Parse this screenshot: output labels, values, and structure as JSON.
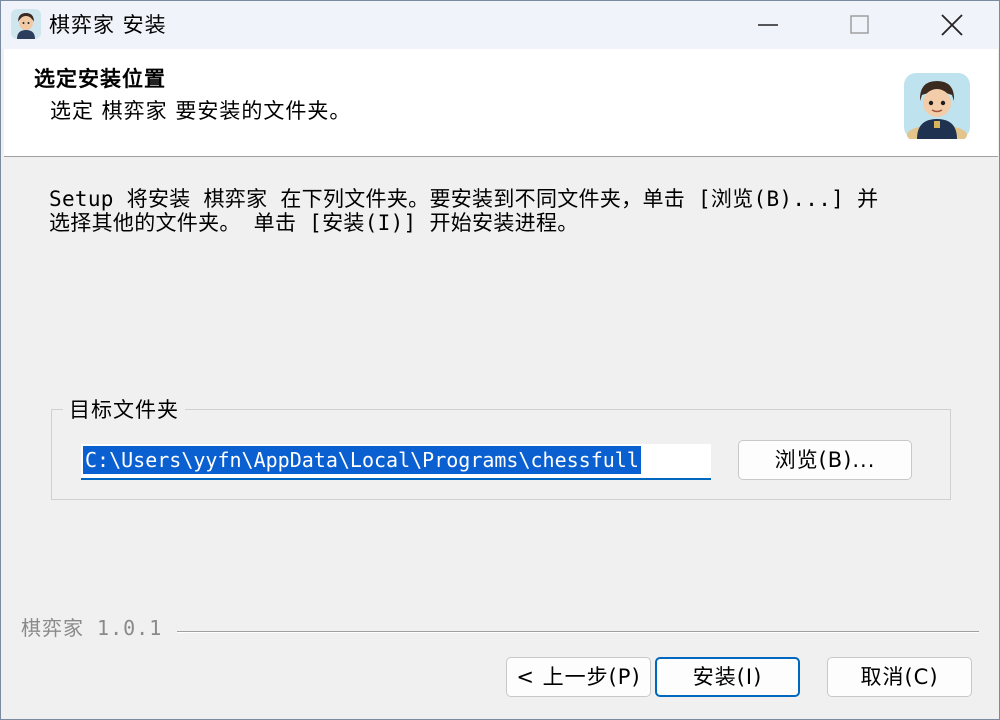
{
  "titlebar": {
    "title": "棋弈家 安装",
    "icon": "app-avatar-icon",
    "buttons": [
      "minimize-icon",
      "maximize-icon",
      "close-icon"
    ]
  },
  "header": {
    "title": "选定安装位置",
    "subtitle": "选定 棋弈家 要安装的文件夹。",
    "logo": "app-avatar-logo"
  },
  "body": {
    "description_line1": "Setup 将安装 棋弈家 在下列文件夹。要安装到不同文件夹，单击 [浏览(B)...] 并",
    "description_line2": "选择其他的文件夹。 单击 [安装(I)] 开始安装进程。"
  },
  "destination": {
    "group_label": "目标文件夹",
    "path": "C:\\Users\\yyfn\\AppData\\Local\\Programs\\chessfull",
    "browse_label": "浏览(B)..."
  },
  "footer": {
    "version": "棋弈家 1.0.1",
    "back_label": "< 上一步(P)",
    "install_label": "安装(I)",
    "cancel_label": "取消(C)"
  },
  "colors": {
    "accent": "#0067c0",
    "selection": "#0a5fd1",
    "background": "#f0f0f0"
  }
}
